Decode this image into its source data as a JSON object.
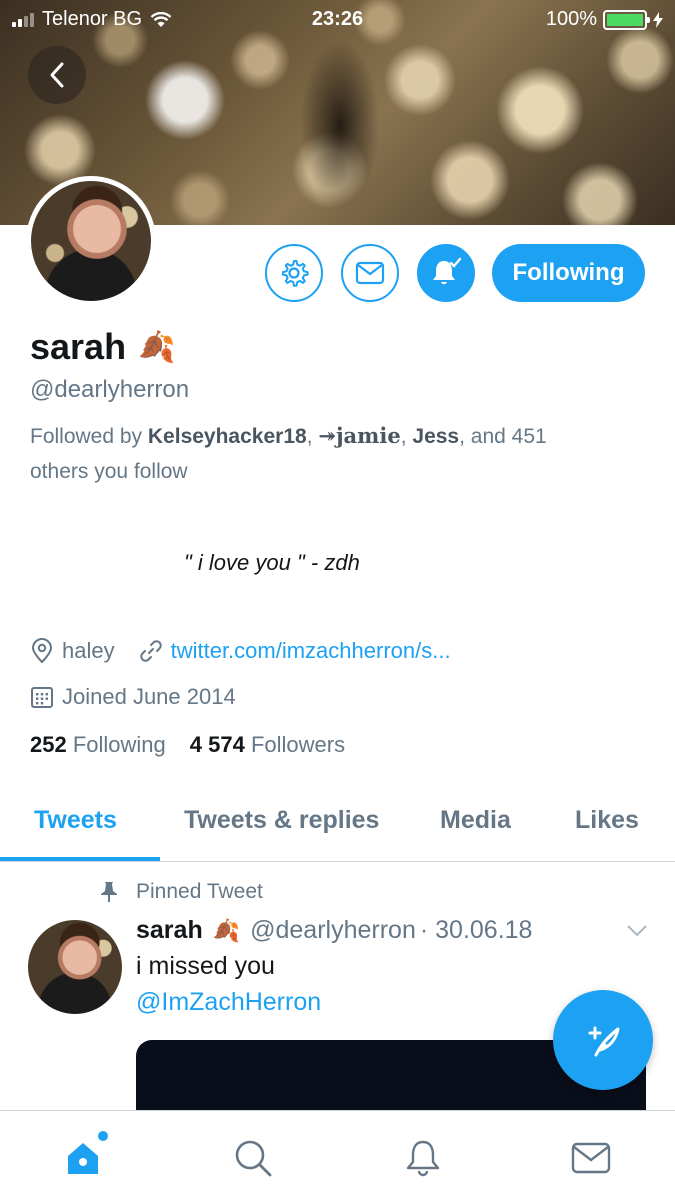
{
  "status_bar": {
    "carrier": "Telenor BG",
    "time": "23:26",
    "battery": "100%"
  },
  "profile": {
    "name": "sarah",
    "name_emoji": "🍂",
    "handle": "@dearlyherron",
    "followed_by_prefix": "Followed by ",
    "followed_by_names": [
      "Kelseyhacker18",
      "↠jamie",
      "Jess"
    ],
    "followed_by_suffix": ", and 451",
    "followed_by_line2": "others you follow",
    "bio": "\" i love you \" - zdh",
    "location": "haley",
    "website": "twitter.com/imzachherron/s...",
    "joined": "Joined June 2014",
    "following_count": "252",
    "following_label": "Following",
    "followers_count": "4 574",
    "followers_label": "Followers",
    "follow_button": "Following"
  },
  "tabs": [
    {
      "label": "Tweets",
      "active": true
    },
    {
      "label": "Tweets & replies",
      "active": false
    },
    {
      "label": "Media",
      "active": false
    },
    {
      "label": "Likes",
      "active": false
    }
  ],
  "tweet": {
    "pinned_label": "Pinned Tweet",
    "name": "sarah",
    "name_emoji": "🍂",
    "handle": "@dearlyherron",
    "date": "· 30.06.18",
    "text": "i missed you",
    "mention": "@ImZachHerron"
  },
  "icons": {
    "back": "chevron-left-icon",
    "settings": "gear-icon",
    "message": "envelope-icon",
    "notifications": "bell-check-icon",
    "location": "location-pin-icon",
    "link": "link-icon",
    "calendar": "calendar-icon",
    "pin": "pin-icon",
    "compose": "compose-feather-icon",
    "nav": [
      "home-icon",
      "search-icon",
      "bell-icon",
      "envelope-icon"
    ]
  },
  "colors": {
    "accent": "#1da1f2",
    "secondary_text": "#657786",
    "primary_text": "#14171a"
  }
}
